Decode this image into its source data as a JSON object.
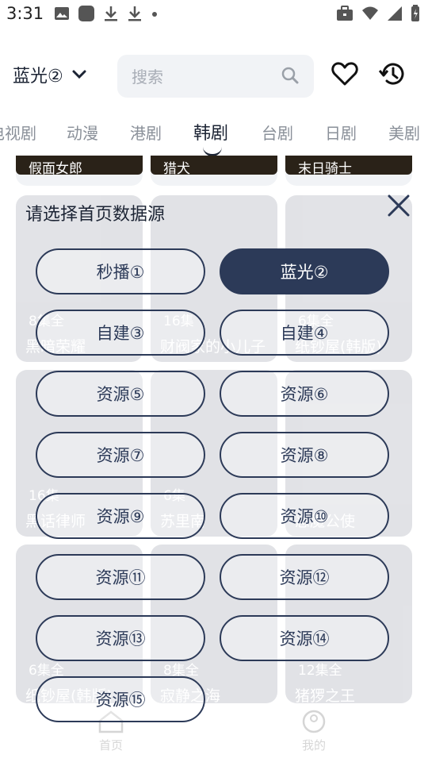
{
  "status": {
    "time": "3:31"
  },
  "header": {
    "source_label": "蓝光②",
    "search_placeholder": "搜索"
  },
  "tabs": [
    {
      "label": "电视剧"
    },
    {
      "label": "动漫"
    },
    {
      "label": "港剧"
    },
    {
      "label": "韩剧"
    },
    {
      "label": "台剧"
    },
    {
      "label": "日剧"
    },
    {
      "label": "美剧"
    }
  ],
  "top_row": [
    {
      "title": "假面女郎"
    },
    {
      "title": "猎犬"
    },
    {
      "title": "末日骑士"
    }
  ],
  "grid": [
    {
      "badge": "8集全",
      "title": "黑暗荣耀"
    },
    {
      "badge": "16集",
      "title": "财阀家的小儿子"
    },
    {
      "badge": "6集全",
      "title": "纸钞屋(韩版)"
    },
    {
      "badge": "16集",
      "title": "黑话律师"
    },
    {
      "badge": "6集",
      "title": "苏里南"
    },
    {
      "badge": "",
      "title": "恶魔公使"
    },
    {
      "badge": "6集全",
      "title": "纸钞屋(韩版)"
    },
    {
      "badge": "8集全",
      "title": "寂静之海"
    },
    {
      "badge": "12集全",
      "title": "猪猡之王"
    }
  ],
  "dialog": {
    "title": "请选择首页数据源",
    "options": [
      {
        "label": "秒播①",
        "selected": false
      },
      {
        "label": "蓝光②",
        "selected": true
      },
      {
        "label": "自建③",
        "selected": false
      },
      {
        "label": "自建④",
        "selected": false
      },
      {
        "label": "资源⑤",
        "selected": false
      },
      {
        "label": "资源⑥",
        "selected": false
      },
      {
        "label": "资源⑦",
        "selected": false
      },
      {
        "label": "资源⑧",
        "selected": false
      },
      {
        "label": "资源⑨",
        "selected": false
      },
      {
        "label": "资源⑩",
        "selected": false
      },
      {
        "label": "资源⑪",
        "selected": false
      },
      {
        "label": "资源⑫",
        "selected": false
      },
      {
        "label": "资源⑬",
        "selected": false
      },
      {
        "label": "资源⑭",
        "selected": false
      },
      {
        "label": "资源⑮",
        "selected": false
      }
    ]
  },
  "bottom_nav": [
    {
      "label": "首页",
      "icon": "home-icon"
    },
    {
      "label": "我的",
      "icon": "profile-icon"
    }
  ],
  "colors": {
    "accent": "#2c3a58",
    "text": "#1c2434",
    "muted": "#8a9099",
    "search_bg": "#f1f3f6"
  }
}
